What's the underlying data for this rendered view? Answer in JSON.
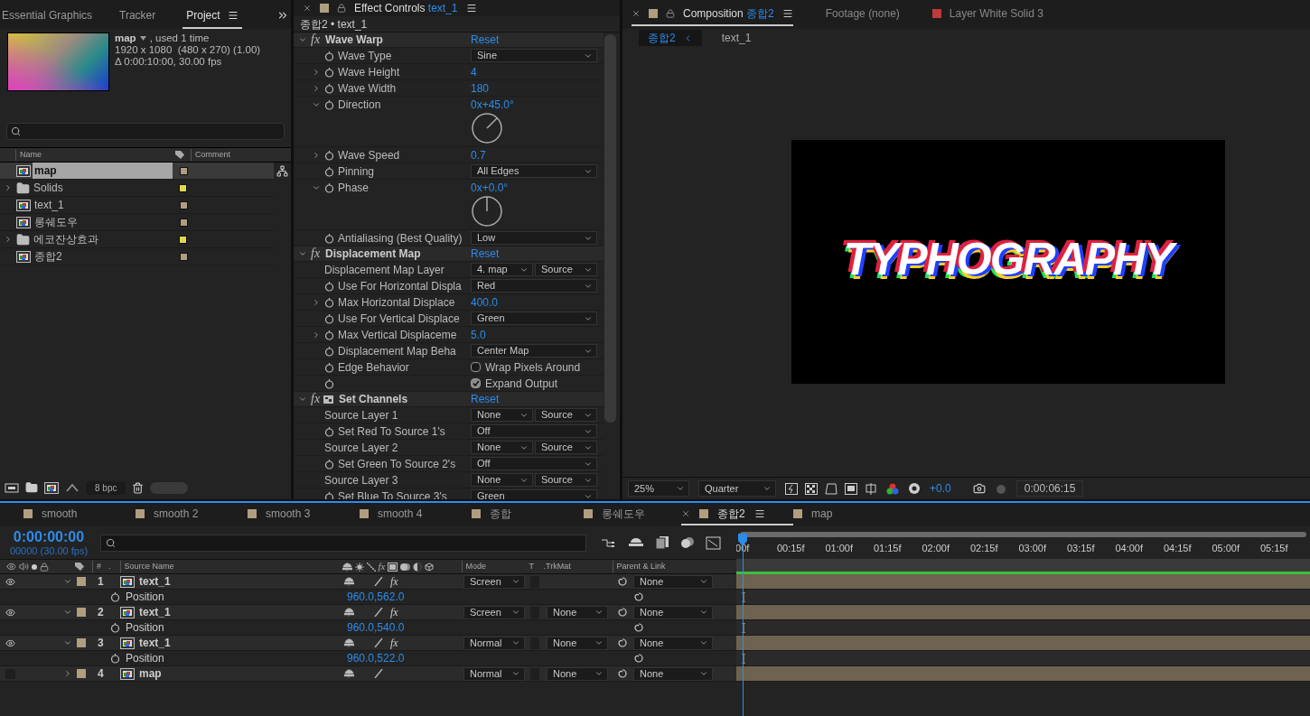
{
  "project": {
    "tabs": [
      {
        "label": "Essential Graphics",
        "selected": false
      },
      {
        "label": "Tracker",
        "selected": false
      },
      {
        "label": "Project",
        "selected": true
      }
    ],
    "preview": {
      "name": "map",
      "usage": ", used 1 time",
      "dimensions": "1920 x 1080  (480 x 270) (1.00)",
      "duration": "Δ 0:00:10:00, 30.00 fps"
    },
    "columns": {
      "name": "Name",
      "comment": "Comment"
    },
    "items": [
      {
        "name": "map",
        "kind": "comp",
        "color": "#b09e7f",
        "selected": true
      },
      {
        "name": "Solids",
        "kind": "folder",
        "color": "#e2d84a",
        "selected": false
      },
      {
        "name": "text_1",
        "kind": "comp",
        "color": "#b09e7f",
        "selected": false
      },
      {
        "name": "롱쉐도우",
        "kind": "comp",
        "color": "#b09e7f",
        "selected": false
      },
      {
        "name": "에코잔상효과",
        "kind": "folder",
        "color": "#e2d84a",
        "selected": false
      },
      {
        "name": "종합2",
        "kind": "comp",
        "color": "#b09e7f",
        "selected": false
      }
    ],
    "bpc": "8 bpc"
  },
  "effect_controls": {
    "title": "Effect Controls",
    "layer": "text_1",
    "color": "#b09e7f",
    "breadcrumb": "종합2 • text_1",
    "effects": [
      {
        "name": "Wave Warp",
        "fx": "fx",
        "legacy": false,
        "reset": "Reset",
        "props": [
          {
            "kind": "dropdown",
            "label": "Wave Type",
            "expandable": false,
            "stopwatch": true,
            "value": "Sine"
          },
          {
            "kind": "number",
            "label": "Wave Height",
            "expandable": true,
            "expanded": false,
            "stopwatch": true,
            "value": "4"
          },
          {
            "kind": "number",
            "label": "Wave Width",
            "expandable": true,
            "expanded": false,
            "stopwatch": true,
            "value": "180"
          },
          {
            "kind": "angle",
            "label": "Direction",
            "expandable": true,
            "expanded": true,
            "stopwatch": true,
            "value": "0x+45.0°"
          },
          {
            "kind": "number",
            "label": "Wave Speed",
            "expandable": true,
            "expanded": false,
            "stopwatch": true,
            "value": "0.7"
          },
          {
            "kind": "dropdown",
            "label": "Pinning",
            "expandable": false,
            "stopwatch": true,
            "value": "All Edges"
          },
          {
            "kind": "angle",
            "label": "Phase",
            "expandable": true,
            "expanded": true,
            "stopwatch": true,
            "value": "0x+0.0°"
          },
          {
            "kind": "dropdown",
            "label": "Antialiasing (Best Quality)",
            "expandable": false,
            "stopwatch": true,
            "value": "Low"
          }
        ]
      },
      {
        "name": "Displacement Map",
        "fx": "fx",
        "legacy": false,
        "reset": "Reset",
        "props": [
          {
            "kind": "dual",
            "label": "Displacement Map Layer",
            "expandable": false,
            "stopwatch": false,
            "value": "4. map",
            "value2": "Source"
          },
          {
            "kind": "dropdown",
            "label": "Use For Horizontal Displa",
            "expandable": false,
            "stopwatch": true,
            "value": "Red"
          },
          {
            "kind": "number",
            "label": "Max Horizontal Displace",
            "expandable": true,
            "expanded": false,
            "stopwatch": true,
            "value": "400.0"
          },
          {
            "kind": "dropdown",
            "label": "Use For Vertical Displace",
            "expandable": false,
            "stopwatch": true,
            "value": "Green"
          },
          {
            "kind": "number",
            "label": "Max Vertical Displaceme",
            "expandable": true,
            "expanded": false,
            "stopwatch": true,
            "value": "5.0"
          },
          {
            "kind": "dropdown",
            "label": "Displacement Map Beha",
            "expandable": false,
            "stopwatch": true,
            "value": "Center Map"
          },
          {
            "kind": "checkbox",
            "label": "Edge Behavior",
            "expandable": false,
            "stopwatch": true,
            "value": "Wrap Pixels Around",
            "checked": false
          },
          {
            "kind": "checkbox",
            "expandable": false,
            "stopwatch": true,
            "value": "Expand Output",
            "checked": true
          }
        ]
      },
      {
        "name": "Set Channels",
        "fx": "fx",
        "legacy": true,
        "reset": "Reset",
        "props": [
          {
            "kind": "dual",
            "label": "Source Layer 1",
            "expandable": false,
            "stopwatch": false,
            "value": "None",
            "value2": "Source"
          },
          {
            "kind": "dropdown",
            "label": "Set Red To Source 1's",
            "expandable": false,
            "stopwatch": true,
            "value": "Off"
          },
          {
            "kind": "dual",
            "label": "Source Layer 2",
            "expandable": false,
            "stopwatch": false,
            "value": "None",
            "value2": "Source"
          },
          {
            "kind": "dropdown",
            "label": "Set Green To Source 2's",
            "expandable": false,
            "stopwatch": true,
            "value": "Off"
          },
          {
            "kind": "dual",
            "label": "Source Layer 3",
            "expandable": false,
            "stopwatch": false,
            "value": "None",
            "value2": "Source"
          },
          {
            "kind": "dropdown",
            "label": "Set Blue To Source 3's",
            "expandable": false,
            "stopwatch": true,
            "value": "Green"
          }
        ]
      }
    ]
  },
  "composition": {
    "tabs": [
      {
        "label": "Composition",
        "name": "종합2",
        "color": "#b09e7f",
        "selected": true
      },
      {
        "label": "Footage",
        "name": "(none)",
        "selected": false
      },
      {
        "label": "Layer",
        "name": "White Solid 3",
        "color": "#c0393b",
        "selected": false
      }
    ],
    "breadcrumb": [
      {
        "label": "종합2",
        "selected": true
      },
      {
        "label": "text_1",
        "selected": false
      }
    ],
    "viewer_text": "TYPHOGRAPHY",
    "toolbar": {
      "zoom": "25%",
      "resolution": "Quarter",
      "exposure": "+0.0",
      "timecode": "0:00:06:15"
    }
  },
  "timeline": {
    "tabs": [
      {
        "label": "smooth",
        "color": "#b09e7f",
        "selected": false
      },
      {
        "label": "smooth 2",
        "color": "#b09e7f",
        "selected": false
      },
      {
        "label": "smooth 3",
        "color": "#b09e7f",
        "selected": false
      },
      {
        "label": "smooth 4",
        "color": "#b09e7f",
        "selected": false
      },
      {
        "label": "종합",
        "color": "#b09e7f",
        "selected": false
      },
      {
        "label": "롱쉐도우",
        "color": "#b09e7f",
        "selected": false
      },
      {
        "label": "종합2",
        "color": "#b09e7f",
        "selected": true
      },
      {
        "label": "map",
        "color": "#b09e7f",
        "selected": false
      }
    ],
    "timecode": "0:00:00:00",
    "frames": "00000 (30.00 fps)",
    "columns": {
      "number": "#",
      "label": ".",
      "source": "Source Name",
      "fx": "fx",
      "mode": "Mode",
      "t": "T",
      "trkmat": ".TrkMat",
      "parent": "Parent & Link"
    },
    "ruler": [
      "00f",
      "00:15f",
      "01:00f",
      "01:15f",
      "02:00f",
      "02:15f",
      "03:00f",
      "03:15f",
      "04:00f",
      "04:15f",
      "05:00f",
      "05:15f"
    ],
    "layers": [
      {
        "number": "1",
        "name": "text_1",
        "color": "#b09e7f",
        "visible": true,
        "expanded": true,
        "fx_switch": "fx",
        "mode": "Screen",
        "parent": "None",
        "property": {
          "name": "Position",
          "value": "960.0,562.0"
        }
      },
      {
        "number": "2",
        "name": "text_1",
        "color": "#b09e7f",
        "visible": true,
        "expanded": true,
        "fx_switch": "fx",
        "mode": "Screen",
        "trkmat": "None",
        "parent": "None",
        "property": {
          "name": "Position",
          "value": "960.0,540.0"
        }
      },
      {
        "number": "3",
        "name": "text_1",
        "color": "#b09e7f",
        "visible": true,
        "expanded": true,
        "fx_switch": "fx",
        "mode": "Normal",
        "trkmat": "None",
        "parent": "None",
        "property": {
          "name": "Position",
          "value": "960.0,522.0"
        }
      },
      {
        "number": "4",
        "name": "map",
        "color": "#b09e7f",
        "visible": false,
        "expanded": false,
        "mode": "Normal",
        "trkmat": "None",
        "parent": "None"
      }
    ]
  }
}
